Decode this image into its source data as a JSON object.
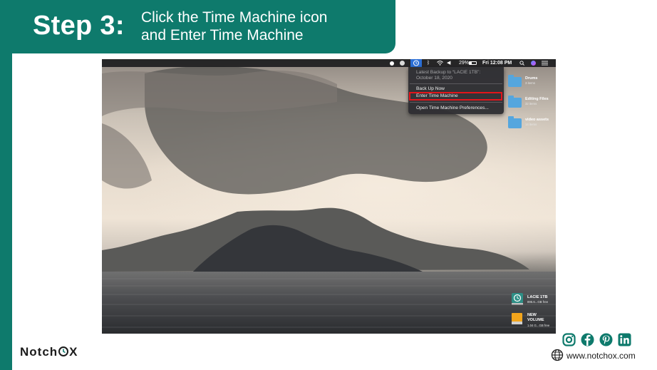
{
  "banner": {
    "step_label": "Step 3:",
    "description_line1": "Click the Time Machine icon",
    "description_line2": "and Enter Time Machine",
    "background_color": "#0e7a6c"
  },
  "menubar": {
    "battery": "29%",
    "datetime": "Fri 12:08 PM",
    "icons": [
      "record-icon",
      "creative-cloud-icon",
      "time-machine-icon",
      "bluetooth-icon",
      "wifi-icon",
      "volume-icon",
      "battery-icon",
      "search-icon",
      "siri-icon",
      "control-list-icon"
    ]
  },
  "time_machine_menu": {
    "latest_backup_line1": "Latest Backup to “LACIE 1TB”:",
    "latest_backup_line2": "October 18, 2020",
    "back_up_now": "Back Up Now",
    "enter_time_machine": "Enter Time Machine",
    "open_preferences": "Open Time Machine Preferences...",
    "highlight_color": "#e3151b"
  },
  "desktop": {
    "folders": [
      {
        "name": "Drums",
        "count": "3 items"
      },
      {
        "name": "Editing Files",
        "count": "32 items"
      },
      {
        "name": "video assets",
        "count": "14 items"
      }
    ],
    "drives": [
      {
        "name": "LACIE 1TB",
        "free": "895.6...GB free"
      },
      {
        "name_line1": "NEW",
        "name_line2": "VOLUME",
        "free": "1.04 G...GB free"
      }
    ]
  },
  "footer": {
    "logo_text_start": "Notch",
    "logo_text_end": "X",
    "website": "www.notchox.com",
    "social_icons": [
      "instagram-icon",
      "facebook-icon",
      "pinterest-icon",
      "linkedin-icon"
    ]
  }
}
